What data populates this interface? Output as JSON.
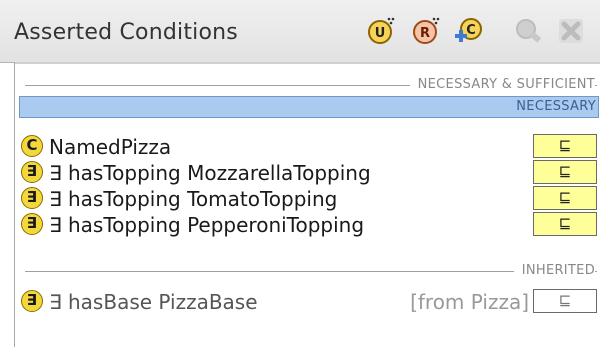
{
  "header": {
    "title": "Asserted Conditions",
    "tools": [
      {
        "name": "add-restriction-tool",
        "icon": "U-circle-icon"
      },
      {
        "name": "add-named-restriction-tool",
        "icon": "R-circle-icon"
      },
      {
        "name": "add-named-class-tool",
        "icon": "C-circle-plus-icon"
      },
      {
        "name": "search-tool",
        "icon": "magnifier-icon"
      },
      {
        "name": "delete-tool",
        "icon": "delete-x-icon"
      }
    ]
  },
  "sections": {
    "necessary_sufficient": "NECESSARY & SUFFICIENT",
    "necessary": "NECESSARY",
    "inherited": "INHERITED"
  },
  "necessary_rows": [
    {
      "badge": "C",
      "text": "NamedPizza",
      "subclass_symbol": "⊑"
    },
    {
      "badge": "∃",
      "text": "∃ hasTopping MozzarellaTopping",
      "subclass_symbol": "⊑"
    },
    {
      "badge": "∃",
      "text": "∃ hasTopping TomatoTopping",
      "subclass_symbol": "⊑"
    },
    {
      "badge": "∃",
      "text": "∃ hasTopping PepperoniTopping",
      "subclass_symbol": "⊑"
    }
  ],
  "inherited_rows": [
    {
      "badge": "∃",
      "text": "∃ hasBase PizzaBase",
      "from": "[from Pizza]",
      "subclass_symbol": "⊑"
    }
  ]
}
